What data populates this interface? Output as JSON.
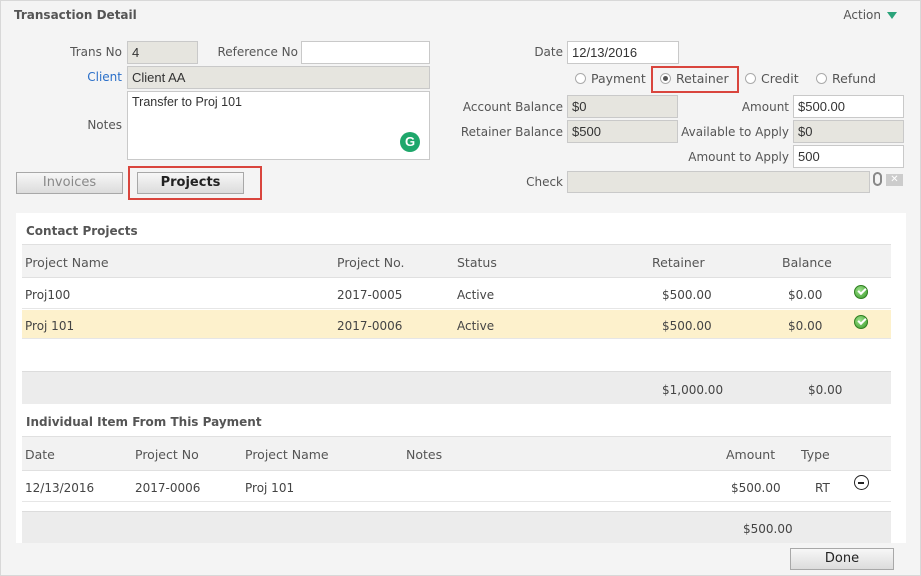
{
  "header": {
    "title": "Transaction Detail",
    "action_label": "Action"
  },
  "form": {
    "trans_no_label": "Trans No",
    "trans_no": "4",
    "reference_no_label": "Reference No",
    "reference_no": "",
    "client_label": "Client",
    "client": "Client AA",
    "notes_label": "Notes",
    "notes": "Transfer to Proj 101",
    "date_label": "Date",
    "date": "12/13/2016",
    "types": [
      "Payment",
      "Retainer",
      "Credit",
      "Refund"
    ],
    "selected_type": "Retainer",
    "account_balance_label": "Account Balance",
    "account_balance": "$0",
    "retainer_balance_label": "Retainer Balance",
    "retainer_balance": "$500",
    "amount_label": "Amount",
    "amount": "$500.00",
    "available_label": "Available to Apply",
    "available": "$0",
    "amount_to_apply_label": "Amount to Apply",
    "amount_to_apply": "500",
    "check_label": "Check",
    "check": ""
  },
  "buttons": {
    "invoices": "Invoices",
    "projects": "Projects",
    "done": "Done"
  },
  "contact_projects": {
    "title": "Contact Projects",
    "columns": [
      "Project Name",
      "Project No.",
      "Status",
      "Retainer",
      "Balance"
    ],
    "rows": [
      {
        "name": "Proj100",
        "no": "2017-0005",
        "status": "Active",
        "retainer": "$500.00",
        "balance": "$0.00"
      },
      {
        "name": "Proj 101",
        "no": "2017-0006",
        "status": "Active",
        "retainer": "$500.00",
        "balance": "$0.00"
      }
    ],
    "total_retainer": "$1,000.00",
    "total_balance": "$0.00"
  },
  "items": {
    "title": "Individual Item From This Payment",
    "columns": [
      "Date",
      "Project No",
      "Project Name",
      "Notes",
      "Amount",
      "Type"
    ],
    "rows": [
      {
        "date": "12/13/2016",
        "project_no": "2017-0006",
        "project_name": "Proj 101",
        "notes": "",
        "amount": "$500.00",
        "type": "RT"
      }
    ],
    "total_amount": "$500.00"
  },
  "colors": {
    "accent_red": "#d9453d",
    "selected_row": "#fdf1cc",
    "check_green": "#3a9b2a",
    "link_blue": "#2a6fc9"
  }
}
